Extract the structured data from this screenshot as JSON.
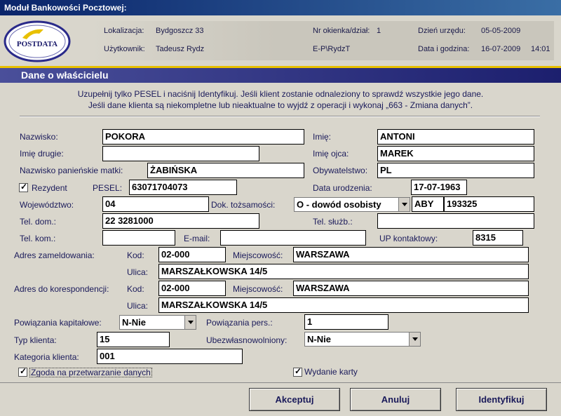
{
  "window": {
    "title": "Moduł Bankowości Pocztowej:"
  },
  "logo": {
    "text": "POSTDATA"
  },
  "header": {
    "lokalizacja_label": "Lokalizacja:",
    "lokalizacja_value": "Bydgoszcz 33",
    "nr_okienka_label": "Nr okienka/dział:",
    "nr_okienka_value": "1",
    "dzien_urzedu_label": "Dzień urzędu:",
    "dzien_urzedu_value": "05-05-2009",
    "uzytkownik_label": "Użytkownik:",
    "uzytkownik_value": "Tadeusz Rydz",
    "user_id": "E-P\\RydzT",
    "data_godzina_label": "Data i godzina:",
    "data_value": "16-07-2009",
    "godzina_value": "14:01"
  },
  "section": {
    "title": "Dane o właścicielu"
  },
  "info": {
    "line1": "Uzupełnij tylko PESEL i naciśnij Identyfikuj. Jeśli klient zostanie odnaleziony to sprawdź wszystkie jego dane.",
    "line2": "Jeśli dane klienta są niekompletne lub nieaktualne to wyjdź z operacji i wykonaj „663 - Zmiana danych”."
  },
  "form": {
    "nazwisko_label": "Nazwisko:",
    "nazwisko": "POKORA",
    "imie_label": "Imię:",
    "imie": "ANTONI",
    "imie_drugie_label": "Imię drugie:",
    "imie_drugie": "",
    "imie_ojca_label": "Imię ojca:",
    "imie_ojca": "MAREK",
    "nazwisko_matki_label": "Nazwisko panieńskie matki:",
    "nazwisko_matki": "ŻABIŃSKA",
    "obywatelstwo_label": "Obywatelstwo:",
    "obywatelstwo": "PL",
    "rezydent_label": "Rezydent",
    "pesel_label": "PESEL:",
    "pesel": "63071704073",
    "data_urodzenia_label": "Data urodzenia:",
    "data_urodzenia": "17-07-1963",
    "wojewodztwo_label": "Województwo:",
    "wojewodztwo": "04",
    "dok_label": "Dok. tożsamości:",
    "dok_typ": "O - dowód osobisty",
    "dok_seria": "ABY",
    "dok_numer": "193325",
    "tel_dom_label": "Tel. dom.:",
    "tel_dom": "22 3281000",
    "tel_sluzb_label": "Tel. służb.:",
    "tel_sluzb": "",
    "tel_kom_label": "Tel. kom.:",
    "tel_kom": "",
    "email_label": "E-mail:",
    "email": "",
    "up_kontaktowy_label": "UP kontaktowy:",
    "up_kontaktowy": "8315",
    "adres_zameldowania_label": "Adres zameldowania:",
    "kod_label": "Kod:",
    "kod_zam": "02-000",
    "miejscowosc_label": "Miejscowość:",
    "miejscowosc_zam": "WARSZAWA",
    "ulica_label": "Ulica:",
    "ulica_zam": "MARSZAŁKOWSKA 14/5",
    "adres_koresp_label": "Adres do korespondencji:",
    "kod_kor": "02-000",
    "miejscowosc_kor": "WARSZAWA",
    "ulica_kor": "MARSZAŁKOWSKA 14/5",
    "powiazania_kap_label": "Powiązania kapitałowe:",
    "powiazania_kap": "N-Nie",
    "powiazania_pers_label": "Powiązania pers.:",
    "powiazania_pers": "1",
    "typ_klienta_label": "Typ klienta:",
    "typ_klienta": "15",
    "ubezwlasnowolniony_label": "Ubezwłasnowolniony:",
    "ubezwlasnowolniony": "N-Nie",
    "kategoria_label": "Kategoria klienta:",
    "kategoria": "001",
    "zgoda_label": "Zgoda na przetwarzanie danych",
    "wydanie_karty_label": "Wydanie karty"
  },
  "buttons": {
    "akceptuj": "Akceptuj",
    "anuluj": "Anuluj",
    "identyfikuj": "Identyfikuj"
  }
}
